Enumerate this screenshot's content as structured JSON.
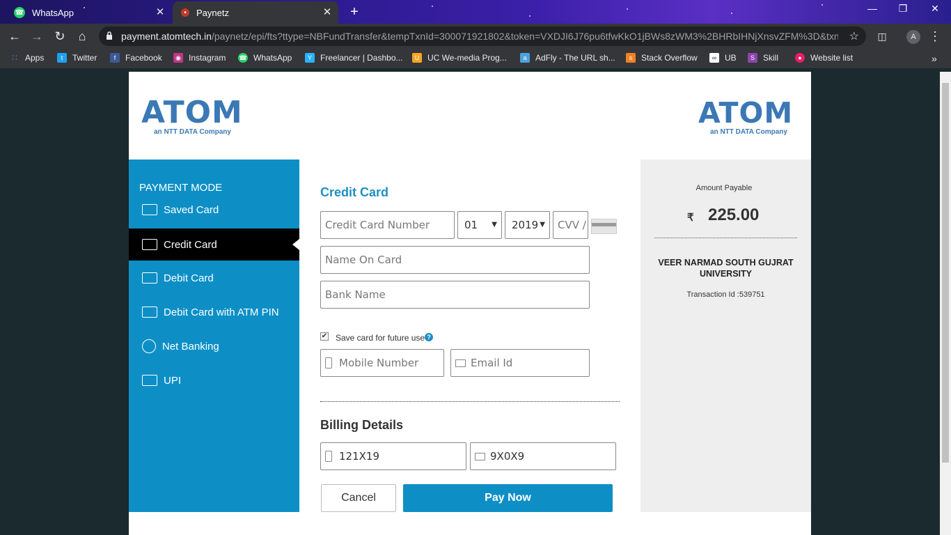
{
  "browser": {
    "tabs": [
      {
        "title": "WhatsApp",
        "icon": "whatsapp-icon",
        "active": false
      },
      {
        "title": "Paynetz",
        "icon": "paynetz-icon",
        "active": true
      }
    ],
    "url_host": "payment.atomtech.in",
    "url_path": "/paynetz/epi/fts?ttype=NBFundTransfer&tempTxnId=300071921802&token=VXDJI6J76pu6tfwKkO1jBWs8zWM3%2BHRbIHNjXnsvZFM%3D&txn...",
    "profile_initial": "A",
    "bookmarks": [
      {
        "label": "Apps",
        "icon": "apps-grid-icon",
        "color": "#4285f4"
      },
      {
        "label": "Twitter",
        "icon": "twitter-icon",
        "color": "#1da1f2"
      },
      {
        "label": "Facebook",
        "icon": "facebook-icon",
        "color": "#3b5998"
      },
      {
        "label": "Instagram",
        "icon": "instagram-icon",
        "color": "#c13584"
      },
      {
        "label": "WhatsApp",
        "icon": "whatsapp-icon",
        "color": "#25d366"
      },
      {
        "label": "Freelancer | Dashbo...",
        "icon": "freelancer-icon",
        "color": "#29b2fe"
      },
      {
        "label": "UC We-media Prog...",
        "icon": "uc-icon",
        "color": "#f5a623"
      },
      {
        "label": "AdFly - The URL sh...",
        "icon": "adfly-icon",
        "color": "#4aa3df"
      },
      {
        "label": "Stack Overflow",
        "icon": "stackoverflow-icon",
        "color": "#f48024"
      },
      {
        "label": "UB",
        "icon": "ub-icon",
        "color": "#ffffff"
      },
      {
        "label": "Skill",
        "icon": "skill-icon",
        "color": "#8e44ad"
      },
      {
        "label": "Website list",
        "icon": "website-list-icon",
        "color": "#e91e63"
      }
    ]
  },
  "logo": {
    "word": "ATOM",
    "sub": "an NTT DATA Company",
    "color": "#3b78b5"
  },
  "sidebar": {
    "heading": "PAYMENT MODE",
    "items": [
      {
        "label": "Saved Card",
        "icon": "wallet-icon",
        "active": false
      },
      {
        "label": "Credit Card",
        "icon": "credit-card-icon",
        "active": true
      },
      {
        "label": "Debit Card",
        "icon": "debit-card-icon",
        "active": false
      },
      {
        "label": "Debit Card with ATM PIN",
        "icon": "atm-card-icon",
        "active": false
      },
      {
        "label": "Net Banking",
        "icon": "globe-icon",
        "active": false
      },
      {
        "label": "UPI",
        "icon": "upi-card-icon",
        "active": false
      }
    ]
  },
  "form": {
    "title": "Credit Card",
    "card_number_placeholder": "Credit Card Number",
    "expiry_month": "01",
    "expiry_year": "2019",
    "cvv_placeholder": "CVV /",
    "name_placeholder": "Name On Card",
    "bank_placeholder": "Bank Name",
    "save_card_label": "Save card for future use",
    "save_card_checked": true,
    "help_glyph": "?",
    "mobile_placeholder": "Mobile Number",
    "email_placeholder": "Email Id",
    "billing_title": "Billing Details",
    "billing_mobile": "121X19",
    "billing_email": "9X0X9",
    "cancel_label": "Cancel",
    "pay_label": "Pay Now",
    "accent": "#0d8fc6"
  },
  "summary": {
    "label": "Amount Payable",
    "currency": "₹",
    "amount": "225.00",
    "merchant": "VEER NARMAD SOUTH GUJRAT UNIVERSITY",
    "transaction": "Transaction Id :539751"
  }
}
